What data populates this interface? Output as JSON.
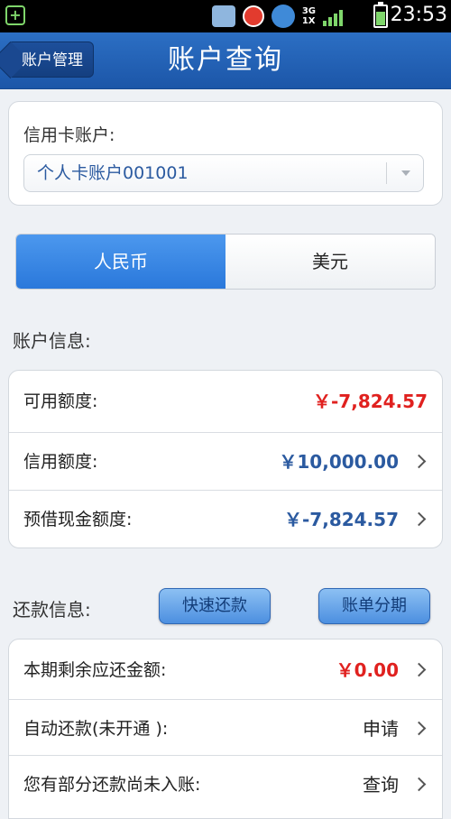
{
  "status_bar": {
    "time": "23:53",
    "network": [
      "3G",
      "1X"
    ]
  },
  "header": {
    "back_label": "账户管理",
    "title": "账户查询"
  },
  "account_card": {
    "label": "信用卡账户:",
    "selected_account": "个人卡账户001001"
  },
  "currency_tabs": [
    {
      "label": "人民币",
      "active": true
    },
    {
      "label": "美元",
      "active": false
    }
  ],
  "account_info": {
    "title": "账户信息:",
    "rows": [
      {
        "label": "可用额度:",
        "value": "￥-7,824.57",
        "color": "#e0211f",
        "has_arrow": false
      },
      {
        "label": "信用额度:",
        "value": "￥10,000.00",
        "color": "#2b5aa0",
        "has_arrow": true
      },
      {
        "label": "预借现金额度:",
        "value": "￥-7,824.57",
        "color": "#2b5aa0",
        "has_arrow": true
      }
    ]
  },
  "repayment_info": {
    "title": "还款信息:",
    "quick_repay_label": "快速还款",
    "installment_label": "账单分期",
    "rows": [
      {
        "label": "本期剩余应还金额:",
        "value": "￥0.00",
        "color": "#e0211f",
        "has_arrow": true
      },
      {
        "label": "自动还款(未开通 ):",
        "value": "申请",
        "color": "#222222",
        "has_arrow": true
      },
      {
        "label": "您有部分还款尚未入账:",
        "value": "查询",
        "color": "#222222",
        "has_arrow": true
      }
    ]
  },
  "colors": {
    "header_blue": "#1c56a8",
    "accent_red": "#e0211f",
    "accent_blue": "#2b5aa0"
  }
}
